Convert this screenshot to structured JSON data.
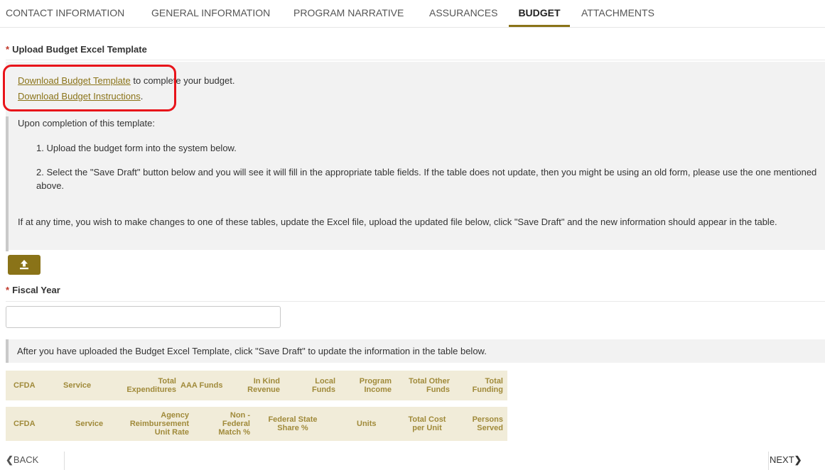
{
  "tabs": [
    {
      "label": "CONTACT INFORMATION"
    },
    {
      "label": "GENERAL INFORMATION"
    },
    {
      "label": "PROGRAM NARRATIVE"
    },
    {
      "label": "ASSURANCES"
    },
    {
      "label": "BUDGET"
    },
    {
      "label": "ATTACHMENTS"
    }
  ],
  "active_tab": "BUDGET",
  "upload_section": {
    "required_mark": "*",
    "title": "Upload Budget Excel Template",
    "download_template_link": "Download Budget Template",
    "download_template_suffix": " to complete your budget.",
    "download_instructions_link": "Download Budget Instructions",
    "download_instructions_suffix": ".",
    "completion_intro": "Upon completion of this template:",
    "steps": [
      "1. Upload the budget form into the system below.",
      "2. Select the \"Save Draft\" button below and you will see it will fill in the appropriate table fields. If the table does not update, then you might be using an old form, please use the one mentioned above."
    ],
    "changes_note": "If at any time, you wish to make changes to one of these tables, update the Excel file, upload the updated file below, click \"Save Draft\" and the new information should appear in the table.",
    "upload_icon": "upload-icon"
  },
  "fiscal_year": {
    "required_mark": "*",
    "label": "Fiscal Year",
    "value": ""
  },
  "table_note": "After you have uploaded the Budget Excel Template, click \"Save Draft\" to update the information in the table below.",
  "table1_headers": [
    "CFDA",
    "Service",
    "Total Expenditures",
    "AAA Funds",
    "In Kind Revenue",
    "Local Funds",
    "Program Income",
    "Total Other Funds",
    "Total Funding"
  ],
  "table2_headers": [
    "CFDA",
    "Service",
    "Agency Reimbursement Unit Rate",
    "Non - Federal Match %",
    "Federal State Share %",
    "Units",
    "Total Cost per Unit",
    "Persons Served"
  ],
  "nav": {
    "back_label": "BACK",
    "next_label": "NEXT"
  },
  "colors": {
    "accent": "#8a7318",
    "header_text": "#a08a3a",
    "table_header_bg": "#f1ecd9",
    "panel_bg": "#f2f2f2",
    "highlight": "#e8141a",
    "required": "#c0392b"
  }
}
